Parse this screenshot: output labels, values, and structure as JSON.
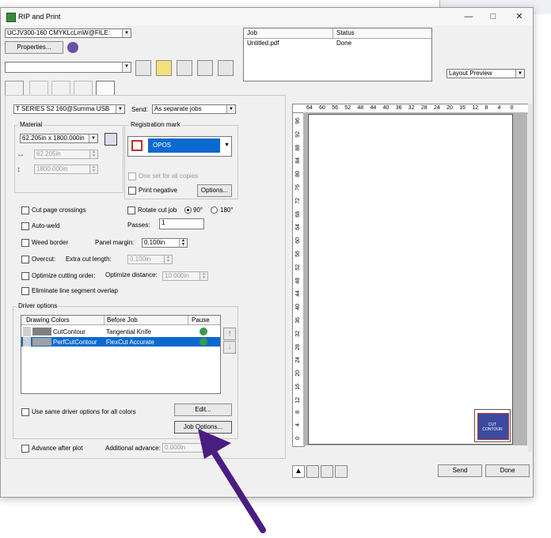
{
  "window": {
    "title": "RIP and Print"
  },
  "printer": {
    "value": "UCJV300-160 CMYKLcLmW@FILE:",
    "properties_label": "Properties..."
  },
  "job_combo": {
    "value": ""
  },
  "job_table": {
    "headers": [
      "Job",
      "Status"
    ],
    "rows": [
      {
        "job": "Untitled.pdf",
        "status": "Done"
      }
    ]
  },
  "view_select": {
    "value": "Layout Preview"
  },
  "cutter": {
    "value": "T SERIES S2 160@Summa USB",
    "send_label": "Send:",
    "send_value": "As separate jobs"
  },
  "material": {
    "group_label": "Material",
    "size_value": "62.205in x 1800.000in",
    "width_value": "62.205in",
    "height_value": "1800.000in"
  },
  "registration": {
    "group_label": "Registration mark",
    "mark_value": "OPOS",
    "one_set_label": "One set for all copies",
    "print_negative_label": "Print negative",
    "options_label": "Options..."
  },
  "options": {
    "cut_page_crossings": "Cut page crossings",
    "rotate_cut_job": "Rotate cut job",
    "rot_90": "90°",
    "rot_180": "180°",
    "auto_weld": "Auto-weld",
    "passes_label": "Passes:",
    "passes_value": "1",
    "weed_border": "Weed border",
    "panel_margin_label": "Panel margin:",
    "panel_margin_value": "0.100in",
    "overcut": "Overcut:",
    "extra_cut_length_label": "Extra cut length:",
    "extra_cut_length_value": "0.100in",
    "optimize_cutting_order": "Optimize cutting order:",
    "optimize_distance_label": "Optimize distance:",
    "optimize_distance_value": "10.000in",
    "eliminate_overlap": "Eliminate line segment overlap"
  },
  "driver_options": {
    "group_label": "Driver options",
    "headers": [
      "Drawing Colors",
      "Before Job",
      "Pause"
    ],
    "rows": [
      {
        "color_name": "CutContour",
        "before_job": "Tangential Knife",
        "swatch": "#808080",
        "selected": false
      },
      {
        "color_name": "PerfCutContour",
        "before_job": "FlexCut Accurate",
        "swatch": "#a0a0a0",
        "selected": true
      }
    ],
    "same_options_label": "Use same driver options for all colors",
    "edit_label": "Edit...",
    "job_options_label": "Job Options..."
  },
  "advance": {
    "after_plot_label": "Advance after plot",
    "additional_label": "Additional advance:",
    "additional_value": "0.000in"
  },
  "ruler": {
    "h_labels": [
      "64",
      "60",
      "56",
      "52",
      "48",
      "44",
      "40",
      "36",
      "32",
      "28",
      "24",
      "20",
      "16",
      "12",
      "8",
      "4",
      "0"
    ],
    "v_labels": [
      "96",
      "92",
      "88",
      "84",
      "80",
      "76",
      "72",
      "68",
      "64",
      "60",
      "56",
      "52",
      "48",
      "44",
      "40",
      "36",
      "32",
      "28",
      "24",
      "20",
      "16",
      "12",
      "8",
      "4",
      "0"
    ]
  },
  "thumbnail": {
    "text": "CUT CONTOUR"
  },
  "footer": {
    "send_label": "Send",
    "done_label": "Done"
  },
  "colors": {
    "selection": "#0a6ad0",
    "accent_arrow": "#4a1d80",
    "titlebar": "#f7f7f7"
  }
}
